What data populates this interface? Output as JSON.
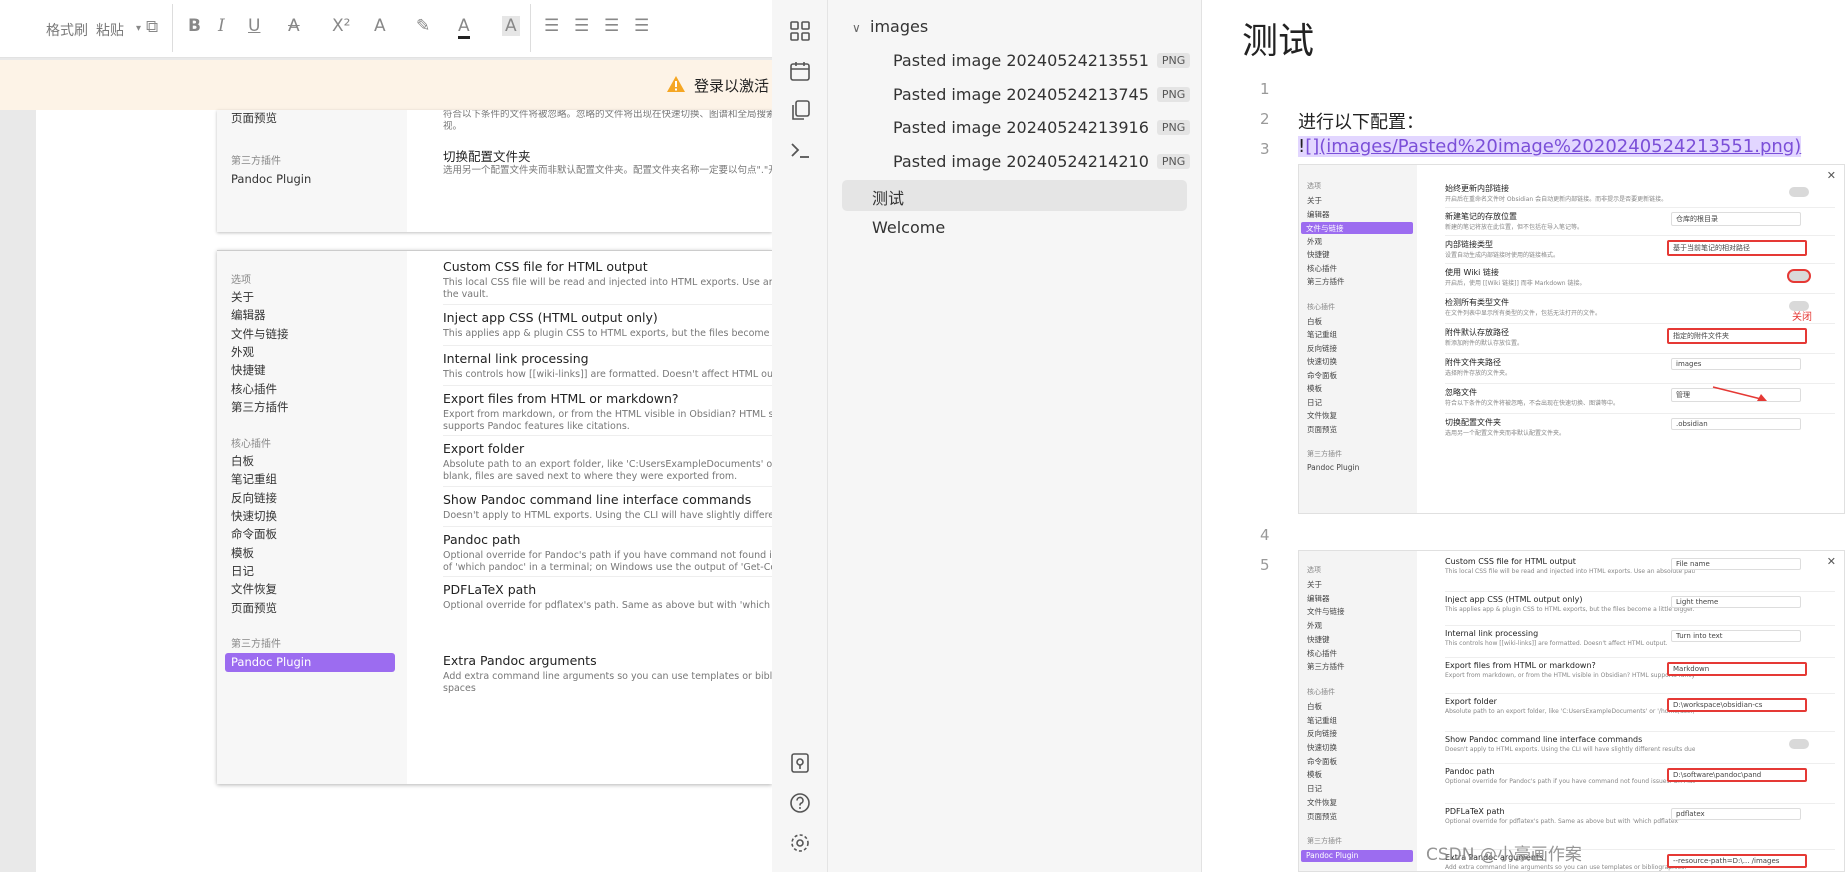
{
  "doc_window": {
    "ribbon": {
      "format_painter": "格式刷",
      "paste": "粘贴",
      "icons": [
        "copy-icon",
        "bold-icon",
        "italic-icon",
        "underline-icon",
        "strikethrough-icon",
        "superscript-icon",
        "text-effect-icon",
        "highlight-icon",
        "font-color-icon",
        "char-shading-icon",
        "align-left-icon",
        "align-center-icon",
        "align-right-icon",
        "justify-icon"
      ]
    },
    "warning": {
      "text": "登录以激活"
    },
    "screenshot1": {
      "sidebar_item": "页面预览",
      "sidebar_section": "第三方插件",
      "sidebar_plugin": "Pandoc Plugin",
      "partial_desc": "符合以下条件的文件将被忽略。忽略的文件将出现在快速切换、图谱和全局搜索中",
      "partial_desc2": "视。",
      "setting_title": "切换配置文件夹",
      "setting_desc": "选用另一个配置文件夹而非默认配置文件夹。配置文件夹名称一定要以句点\".\"开头"
    },
    "screenshot2": {
      "sidebar": {
        "section_options": "选项",
        "options": [
          "关于",
          "编辑器",
          "文件与链接",
          "外观",
          "快捷键",
          "核心插件",
          "第三方插件"
        ],
        "section_core": "核心插件",
        "core": [
          "白板",
          "笔记重组",
          "反向链接",
          "快速切换",
          "命令面板",
          "模板",
          "日记",
          "文件恢复",
          "页面预览"
        ],
        "section_third": "第三方插件",
        "third_active": "Pandoc Plugin"
      },
      "settings": [
        {
          "title": "Custom CSS file for HTML output",
          "desc": "This local CSS file will be read and injected into HTML exports. Use an absolute path",
          "desc2": "the vault."
        },
        {
          "title": "Inject app CSS (HTML output only)",
          "desc": "This applies app & plugin CSS to HTML exports, but the files become a little bigger.",
          "desc2": ""
        },
        {
          "title": "Internal link processing",
          "desc": "This controls how [[wiki-links]] are formatted. Doesn't affect HTML output.",
          "desc2": ""
        },
        {
          "title": "Export files from HTML or markdown?",
          "desc": "Export from markdown, or from the HTML visible in Obsidian? HTML supports fancy",
          "desc2": "supports Pandoc features like citations."
        },
        {
          "title": "Export folder",
          "desc": "Absolute path to an export folder, like 'C:UsersExampleDocuments' or '/home/user",
          "desc2": "blank, files are saved next to where they were exported from."
        },
        {
          "title": "Show Pandoc command line interface commands",
          "desc": "Doesn't apply to HTML exports. Using the CLI will have slightly different results du",
          "desc2": ""
        },
        {
          "title": "Pandoc path",
          "desc": "Optional override for Pandoc's path if you have command not found issues. On M",
          "desc2": "of 'which pandoc' in a terminal; on Windows use the output of 'Get-Command pan"
        },
        {
          "title": "PDFLaTeX path",
          "desc": "Optional override for pdflatex's path. Same as above but with 'which pdflatex'",
          "desc2": ""
        },
        {
          "title": "Extra Pandoc arguments",
          "desc": "Add extra command line arguments so you can use templates or bibliographies. N",
          "desc2": "spaces"
        }
      ]
    }
  },
  "obsidian": {
    "ribbon_icons": [
      "file-explorer-icon",
      "calendar-icon",
      "copy-pages-icon",
      "terminal-icon"
    ],
    "ribbon_bottom_icons": [
      "vault-switch-icon",
      "help-icon",
      "settings-gear-icon"
    ],
    "explorer": {
      "folder": "images",
      "files": [
        {
          "name": "Pasted image 20240524213551",
          "ext": "PNG"
        },
        {
          "name": "Pasted image 20240524213745",
          "ext": "PNG"
        },
        {
          "name": "Pasted image 20240524213916",
          "ext": "PNG"
        },
        {
          "name": "Pasted image 20240524214210",
          "ext": "PNG"
        }
      ],
      "notes": [
        {
          "name": "测试",
          "active": true
        },
        {
          "name": "Welcome",
          "active": false
        }
      ]
    },
    "editor": {
      "title": "测试",
      "line_numbers": [
        "1",
        "2",
        "3",
        "4",
        "5"
      ],
      "line2": "进行以下配置：",
      "line3_bang": "!",
      "line3_link": "[](images/Pasted%20image%2020240524213551.png)",
      "embed1": {
        "sidebar": {
          "section_options": "选项",
          "options": [
            "关于",
            "编辑器",
            "文件与链接",
            "外观",
            "快捷键",
            "核心插件",
            "第三方插件"
          ],
          "active": "文件与链接",
          "section_core": "核心插件",
          "core": [
            "白板",
            "笔记重组",
            "反向链接",
            "快速切换",
            "命令面板",
            "模板",
            "日记",
            "文件恢复",
            "页面预览"
          ],
          "section_third": "第三方插件",
          "third": "Pandoc Plugin"
        },
        "settings": [
          {
            "title": "始终更新内部链接",
            "desc": "开启后在重命名文件时 Obsidian 会自动更新内部链接。而非提示是否要更新链接。",
            "control": "toggle",
            "red": false
          },
          {
            "title": "新建笔记的存放位置",
            "desc": "新建的笔记将放在此位置，但不包括在导入笔记等。",
            "control": "仓库的根目录",
            "red": false
          },
          {
            "title": "内部链接类型",
            "desc": "设置自动生成内部链接时使用的链接格式。",
            "control": "基于当前笔记的相对路径",
            "red": true
          },
          {
            "title": "使用 Wiki 链接",
            "desc": "开启后，使用 [[Wiki 链接]] 而非 Markdown 链接。",
            "control": "toggle",
            "red": true
          },
          {
            "title": "检测所有类型文件",
            "desc": "在文件列表中显示所有类型的文件，包括无法打开的文件。",
            "control": "toggle",
            "red": false
          },
          {
            "title": "附件默认存放路径",
            "desc": "新添加附件的默认存放位置。",
            "control": "指定的附件文件夹",
            "red": true
          },
          {
            "title": "附件文件夹路径",
            "desc": "选择附件存放的文件夹。",
            "control": "images",
            "red": false
          },
          {
            "title": "忽略文件",
            "desc": "符合以下条件的文件将被忽略，不会出现在快速切换、图谱等中。",
            "control": "管理",
            "red": false
          },
          {
            "title": "切换配置文件夹",
            "desc": "选用另一个配置文件夹而非默认配置文件夹。",
            "control": ".obsidian",
            "red": false
          }
        ],
        "close_note": "关闭"
      },
      "embed2": {
        "sidebar": {
          "section_options": "选项",
          "options": [
            "关于",
            "编辑器",
            "文件与链接",
            "外观",
            "快捷键",
            "核心插件",
            "第三方插件"
          ],
          "section_core": "核心插件",
          "core": [
            "白板",
            "笔记重组",
            "反向链接",
            "快速切换",
            "命令面板",
            "模板",
            "日记",
            "文件恢复",
            "页面预览"
          ],
          "section_third": "第三方插件",
          "third_active": "Pandoc Plugin"
        },
        "settings": [
          {
            "title": "Custom CSS file for HTML output",
            "desc": "This local CSS file will be read and injected into HTML exports. Use an absolute path or a path relative to the vault.",
            "control": "File name",
            "red": false
          },
          {
            "title": "Inject app CSS (HTML output only)",
            "desc": "This applies app & plugin CSS to HTML exports, but the files become a little bigger.",
            "control": "Light theme",
            "red": false
          },
          {
            "title": "Internal link processing",
            "desc": "This controls how [[wiki-links]] are formatted. Doesn't affect HTML output.",
            "control": "Turn into text",
            "red": false
          },
          {
            "title": "Export files from HTML or markdown?",
            "desc": "Export from markdown, or from the HTML visible in Obsidian? HTML supports fancy plugin features, markdown supports Pandoc features like citations.",
            "control": "Markdown",
            "red": true
          },
          {
            "title": "Export folder",
            "desc": "Absolute path to an export folder, like 'C:UsersExampleDocuments' or '/home/user/zettelkasten'. If left blank, files are saved next to where they were exported from.",
            "control": "D:\\workspace\\obsidian-cs",
            "red": true
          },
          {
            "title": "Show Pandoc command line interface commands",
            "desc": "Doesn't apply to HTML exports. Using the CLI will have slightly different results due to how this plugin works.",
            "control": "toggle",
            "red": false
          },
          {
            "title": "Pandoc path",
            "desc": "Optional override for Pandoc's path if you have command not found issues. On Mac/Linux use the output of 'which pandoc' in a terminal; on Windows use the output of 'Get-Command pandoc' in powershell.",
            "control": "D:\\software\\pandoc\\pand",
            "red": true
          },
          {
            "title": "PDFLaTeX path",
            "desc": "Optional override for pdflatex's path. Same as above but with 'which pdflatex'",
            "control": "pdflatex",
            "red": false
          },
          {
            "title": "Extra Pandoc arguments",
            "desc": "Add extra command line arguments so you can use templates or bibliographies.",
            "control": "--resource-path=D:\\... /images",
            "red": true
          }
        ]
      }
    }
  },
  "watermark": "CSDN @小豪画作案",
  "colors": {
    "accent": "#9c6cf0",
    "link": "#7b4fd8",
    "link_bg": "#e2d6ff",
    "highlight_red": "#e53935",
    "warn_bg": "#fdf3e7",
    "warn_icon": "#f5a623"
  }
}
